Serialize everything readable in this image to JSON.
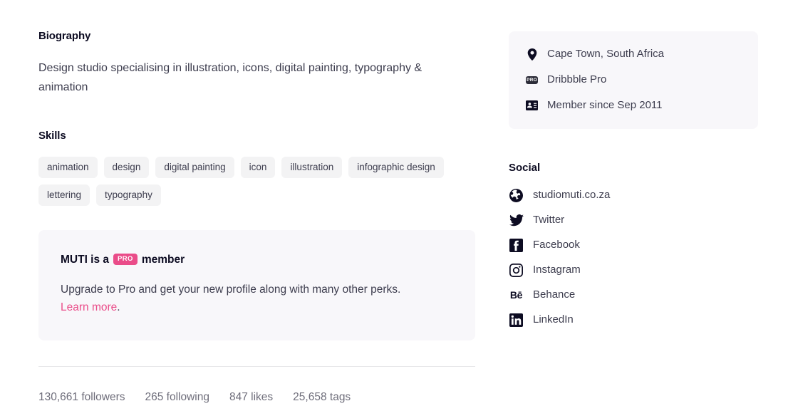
{
  "biography": {
    "heading": "Biography",
    "text": "Design studio specialising in illustration, icons, digital painting, typography & animation"
  },
  "skills": {
    "heading": "Skills",
    "tags": [
      "animation",
      "design",
      "digital painting",
      "icon",
      "illustration",
      "infographic design",
      "lettering",
      "typography"
    ]
  },
  "promo": {
    "title_prefix": "MUTI is a",
    "badge": "PRO",
    "title_suffix": "member",
    "body": "Upgrade to Pro and get your new profile along with many other perks.",
    "link": "Learn more",
    "link_period": ".",
    "accent_color": "#ea4c89",
    "background_color": "#f8f7fa"
  },
  "stats": [
    {
      "value": "130,661",
      "label": "followers",
      "text": "130,661 followers"
    },
    {
      "value": "265",
      "label": "following",
      "text": "265 following"
    },
    {
      "value": "847",
      "label": "likes",
      "text": "847 likes"
    },
    {
      "value": "25,658",
      "label": "tags",
      "text": "25,658 tags"
    }
  ],
  "info_card": {
    "background_color": "#f8f7fa",
    "rows": [
      {
        "icon": "location-pin-icon",
        "text": "Cape Town, South Africa"
      },
      {
        "icon": "pro-badge-icon",
        "text": "Dribbble Pro"
      },
      {
        "icon": "member-card-icon",
        "text": "Member since Sep 2011"
      }
    ]
  },
  "social": {
    "heading": "Social",
    "links": [
      {
        "icon": "globe-icon",
        "label": "studiomuti.co.za"
      },
      {
        "icon": "twitter-icon",
        "label": "Twitter"
      },
      {
        "icon": "facebook-icon",
        "label": "Facebook"
      },
      {
        "icon": "instagram-icon",
        "label": "Instagram"
      },
      {
        "icon": "behance-icon",
        "label": "Behance"
      },
      {
        "icon": "linkedin-icon",
        "label": "LinkedIn"
      }
    ]
  }
}
